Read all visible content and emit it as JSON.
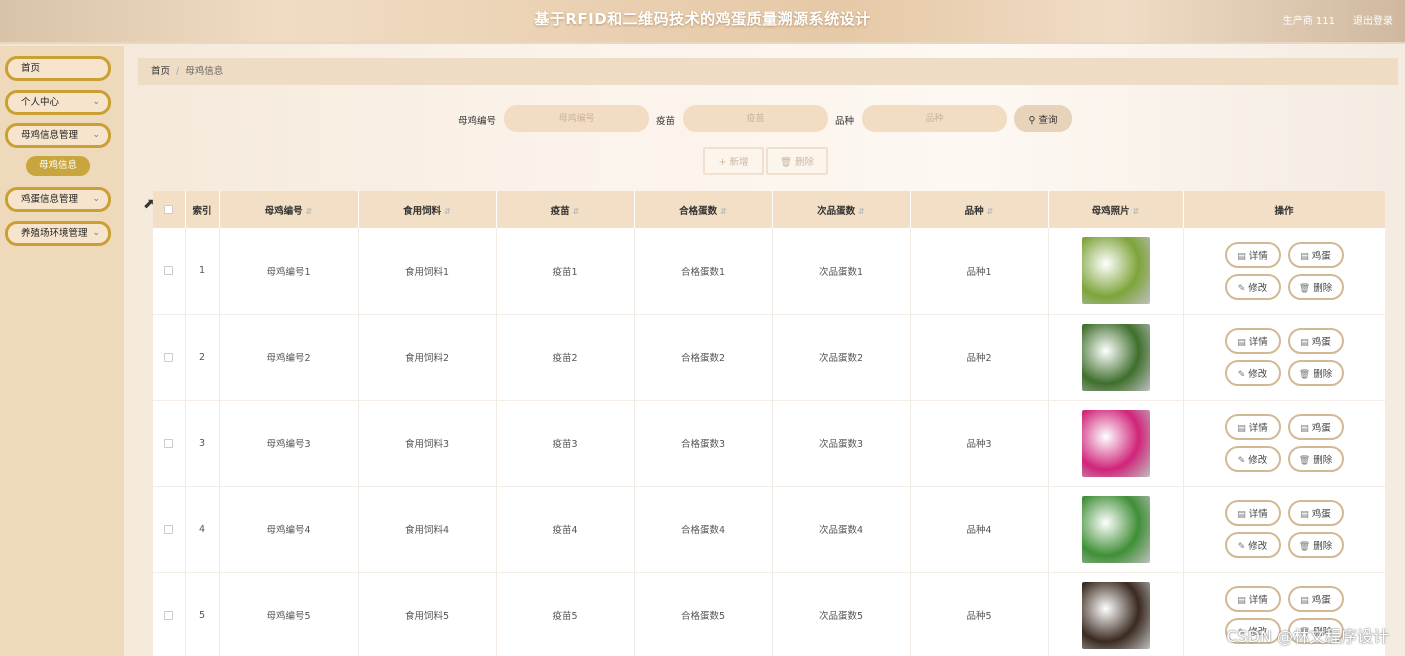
{
  "header": {
    "title": "基于RFID和二维码技术的鸡蛋质量溯源系统设计",
    "user": "生产商 111",
    "logout": "退出登录"
  },
  "sidebar": {
    "items": [
      {
        "label": "首页",
        "has_arrow": false
      },
      {
        "label": "个人中心",
        "has_arrow": true
      },
      {
        "label": "母鸡信息管理",
        "has_arrow": true
      },
      {
        "label": "鸡蛋信息管理",
        "has_arrow": true
      },
      {
        "label": "养殖场环境管理",
        "has_arrow": true
      }
    ],
    "active_sub": "母鸡信息"
  },
  "breadcrumb": {
    "home": "首页",
    "sep": "/",
    "current": "母鸡信息"
  },
  "search": {
    "fields": [
      {
        "label": "母鸡编号",
        "placeholder": "母鸡编号"
      },
      {
        "label": "疫苗",
        "placeholder": "疫苗"
      },
      {
        "label": "品种",
        "placeholder": "品种"
      }
    ],
    "query_label": "查询",
    "add_label": "新增",
    "delete_label": "删除"
  },
  "table": {
    "headers": [
      "索引",
      "母鸡编号",
      "食用饲料",
      "疫苗",
      "合格蛋数",
      "次品蛋数",
      "品种",
      "母鸡照片",
      "操作"
    ],
    "sortable": [
      false,
      true,
      true,
      true,
      true,
      true,
      true,
      true,
      false
    ],
    "rows": [
      {
        "index": "1",
        "code": "母鸡编号1",
        "feed": "食用饲料1",
        "vaccine": "疫苗1",
        "good": "合格蛋数1",
        "bad": "次品蛋数1",
        "breed": "品种1",
        "photo": "green-fruit"
      },
      {
        "index": "2",
        "code": "母鸡编号2",
        "feed": "食用饲料2",
        "vaccine": "疫苗2",
        "good": "合格蛋数2",
        "bad": "次品蛋数2",
        "breed": "品种2",
        "photo": "leafy-greens-basket"
      },
      {
        "index": "3",
        "code": "母鸡编号3",
        "feed": "食用饲料3",
        "vaccine": "疫苗3",
        "good": "合格蛋数3",
        "bad": "次品蛋数3",
        "breed": "品种3",
        "photo": "dragon-fruit"
      },
      {
        "index": "4",
        "code": "母鸡编号4",
        "feed": "食用饲料4",
        "vaccine": "疫苗4",
        "good": "合格蛋数4",
        "bad": "次品蛋数4",
        "breed": "品种4",
        "photo": "green-beans"
      },
      {
        "index": "5",
        "code": "母鸡编号5",
        "feed": "食用饲料5",
        "vaccine": "疫苗5",
        "good": "合格蛋数5",
        "bad": "次品蛋数5",
        "breed": "品种5",
        "photo": "black-beans-bowl"
      }
    ],
    "row_actions": {
      "detail": "详情",
      "egg": "鸡蛋",
      "edit": "修改",
      "delete": "删除"
    },
    "photo_colors": {
      "green-fruit": "#7ea43a",
      "leafy-greens-basket": "#3f6f2c",
      "dragon-fruit": "#d0247a",
      "green-beans": "#3f8f36",
      "black-beans-bowl": "#3a2a20"
    }
  },
  "watermark": "CSDN @林文程序设计"
}
